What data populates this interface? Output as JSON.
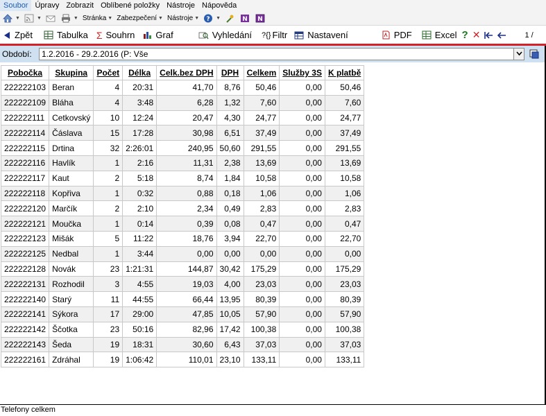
{
  "menu": {
    "items": [
      "Soubor",
      "Úpravy",
      "Zobrazit",
      "Oblíbené položky",
      "Nástroje",
      "Nápověda"
    ]
  },
  "commandbar": {
    "page_label": "Stránka",
    "security_label": "Zabezpečení",
    "tools_label": "Nástroje"
  },
  "toolbar": {
    "back": "Zpět",
    "table": "Tabulka",
    "summary": "Souhrn",
    "graph": "Graf",
    "search": "Vyhledání",
    "filter": "Filtr",
    "settings": "Nastavení",
    "pdf": "PDF",
    "excel": "Excel",
    "page": "1 /"
  },
  "period": {
    "label": "Období:",
    "value": "1.2.2016 - 29.2.2016 (P: Vše"
  },
  "table": {
    "columns": [
      "Pobočka",
      "Skupina",
      "Počet",
      "Délka",
      "Celk.bez DPH",
      "DPH",
      "Celkem",
      "Služby 3S",
      "K platbě"
    ],
    "rows": [
      [
        "222222103",
        "Beran",
        "4",
        "20:31",
        "41,70",
        "8,76",
        "50,46",
        "0,00",
        "50,46"
      ],
      [
        "222222109",
        "Bláha",
        "4",
        "3:48",
        "6,28",
        "1,32",
        "7,60",
        "0,00",
        "7,60"
      ],
      [
        "222222111",
        "Cetkovský",
        "10",
        "12:24",
        "20,47",
        "4,30",
        "24,77",
        "0,00",
        "24,77"
      ],
      [
        "222222114",
        "Čáslava",
        "15",
        "17:28",
        "30,98",
        "6,51",
        "37,49",
        "0,00",
        "37,49"
      ],
      [
        "222222115",
        "Drtina",
        "32",
        "2:26:01",
        "240,95",
        "50,60",
        "291,55",
        "0,00",
        "291,55"
      ],
      [
        "222222116",
        "Havlík",
        "1",
        "2:16",
        "11,31",
        "2,38",
        "13,69",
        "0,00",
        "13,69"
      ],
      [
        "222222117",
        "Kaut",
        "2",
        "5:18",
        "8,74",
        "1,84",
        "10,58",
        "0,00",
        "10,58"
      ],
      [
        "222222118",
        "Kopřiva",
        "1",
        "0:32",
        "0,88",
        "0,18",
        "1,06",
        "0,00",
        "1,06"
      ],
      [
        "222222120",
        "Marčík",
        "2",
        "2:10",
        "2,34",
        "0,49",
        "2,83",
        "0,00",
        "2,83"
      ],
      [
        "222222121",
        "Moučka",
        "1",
        "0:14",
        "0,39",
        "0,08",
        "0,47",
        "0,00",
        "0,47"
      ],
      [
        "222222123",
        "Mišák",
        "5",
        "11:22",
        "18,76",
        "3,94",
        "22,70",
        "0,00",
        "22,70"
      ],
      [
        "222222125",
        "Nedbal",
        "1",
        "3:44",
        "0,00",
        "0,00",
        "0,00",
        "0,00",
        "0,00"
      ],
      [
        "222222128",
        "Novák",
        "23",
        "1:21:31",
        "144,87",
        "30,42",
        "175,29",
        "0,00",
        "175,29"
      ],
      [
        "222222131",
        "Rozhodil",
        "3",
        "4:55",
        "19,03",
        "4,00",
        "23,03",
        "0,00",
        "23,03"
      ],
      [
        "222222140",
        "Starý",
        "11",
        "44:55",
        "66,44",
        "13,95",
        "80,39",
        "0,00",
        "80,39"
      ],
      [
        "222222141",
        "Sýkora",
        "17",
        "29:00",
        "47,85",
        "10,05",
        "57,90",
        "0,00",
        "57,90"
      ],
      [
        "222222142",
        "Ščotka",
        "23",
        "50:16",
        "82,96",
        "17,42",
        "100,38",
        "0,00",
        "100,38"
      ],
      [
        "222222143",
        "Šeda",
        "19",
        "18:31",
        "30,60",
        "6,43",
        "37,03",
        "0,00",
        "37,03"
      ],
      [
        "222222161",
        "Zdráhal",
        "19",
        "1:06:42",
        "110,01",
        "23,10",
        "133,11",
        "0,00",
        "133,11"
      ]
    ]
  },
  "status": {
    "text": "Telefony celkem"
  },
  "colors": {
    "accent_red": "#d42029",
    "period_bar": "#cfe1f1",
    "menu_active": "#1b5fb5"
  }
}
